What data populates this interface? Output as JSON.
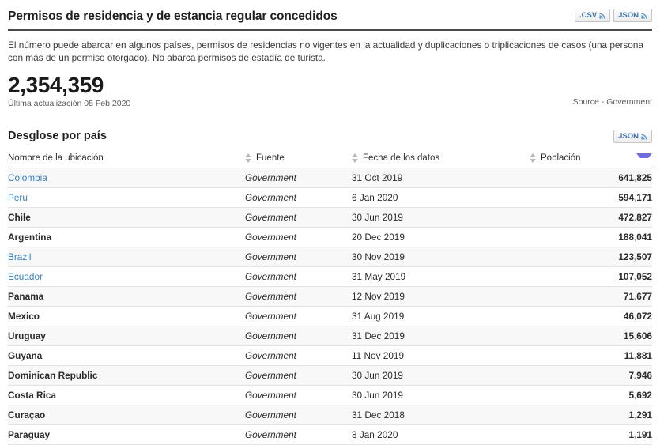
{
  "header": {
    "title": "Permisos de residencia y de estancia regular concedidos",
    "buttons": [
      {
        "label": ".CSV",
        "icon": "rss-feed-icon"
      },
      {
        "label": "JSON",
        "icon": "rss-feed-icon"
      }
    ]
  },
  "description": "El número puede abarcar en algunos países, permisos de residencias no vigentes en la actualidad y duplicaciones o triplicaciones de casos (una persona con más de un permiso otorgado). No abarca permisos de estadía de turista.",
  "stat": {
    "value": "2,354,359",
    "updated": "Última actualización 05 Feb 2020",
    "source": "Source - Government"
  },
  "section": {
    "title": "Desglose por país",
    "button": {
      "label": "JSON",
      "icon": "rss-feed-icon"
    }
  },
  "table": {
    "columns": [
      {
        "label": "Nombre de la ubicación",
        "sort": "both"
      },
      {
        "label": "Fuente",
        "sort": "both"
      },
      {
        "label": "Fecha de los datos",
        "sort": "both"
      },
      {
        "label": "Población",
        "sort": "desc"
      }
    ],
    "rows": [
      {
        "location": "Colombia",
        "is_link": true,
        "source": "Government",
        "date": "31 Oct 2019",
        "population": "641,825"
      },
      {
        "location": "Peru",
        "is_link": true,
        "source": "Government",
        "date": "6 Jan 2020",
        "population": "594,171"
      },
      {
        "location": "Chile",
        "is_link": false,
        "source": "Government",
        "date": "30 Jun 2019",
        "population": "472,827"
      },
      {
        "location": "Argentina",
        "is_link": false,
        "source": "Government",
        "date": "20 Dec 2019",
        "population": "188,041"
      },
      {
        "location": "Brazil",
        "is_link": true,
        "source": "Government",
        "date": "30 Nov 2019",
        "population": "123,507"
      },
      {
        "location": "Ecuador",
        "is_link": true,
        "source": "Government",
        "date": "31 May 2019",
        "population": "107,052"
      },
      {
        "location": "Panama",
        "is_link": false,
        "source": "Government",
        "date": "12 Nov 2019",
        "population": "71,677"
      },
      {
        "location": "Mexico",
        "is_link": false,
        "source": "Government",
        "date": "31 Aug 2019",
        "population": "46,072"
      },
      {
        "location": "Uruguay",
        "is_link": false,
        "source": "Government",
        "date": "31 Dec 2019",
        "population": "15,606"
      },
      {
        "location": "Guyana",
        "is_link": false,
        "source": "Government",
        "date": "11 Nov 2019",
        "population": "11,881"
      },
      {
        "location": "Dominican Republic",
        "is_link": false,
        "source": "Government",
        "date": "30 Jun 2019",
        "population": "7,946"
      },
      {
        "location": "Costa Rica",
        "is_link": false,
        "source": "Government",
        "date": "30 Jun 2019",
        "population": "5,692"
      },
      {
        "location": "Curaçao",
        "is_link": false,
        "source": "Government",
        "date": "31 Dec 2018",
        "population": "1,291"
      },
      {
        "location": "Paraguay",
        "is_link": false,
        "source": "Government",
        "date": "8 Jan 2020",
        "population": "1,191"
      }
    ]
  },
  "colors": {
    "link": "#3c7fb8",
    "rule": "#4a4a4a",
    "sort_active": "#6e6ede",
    "row_stripe": "#f8f8f8"
  }
}
